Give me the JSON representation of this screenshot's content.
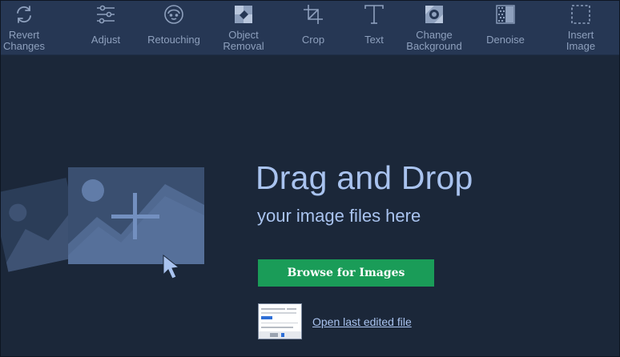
{
  "toolbar": {
    "items": [
      {
        "label": "Revert\nChanges",
        "icon": "revert-icon"
      },
      {
        "label": "Adjust",
        "icon": "sliders-icon"
      },
      {
        "label": "Retouching",
        "icon": "face-icon"
      },
      {
        "label": "Object\nRemoval",
        "icon": "eraser-icon"
      },
      {
        "label": "Crop",
        "icon": "crop-icon"
      },
      {
        "label": "Text",
        "icon": "text-icon"
      },
      {
        "label": "Change\nBackground",
        "icon": "background-icon"
      },
      {
        "label": "Denoise",
        "icon": "denoise-icon"
      },
      {
        "label": "Insert\nImage",
        "icon": "insert-image-icon"
      }
    ]
  },
  "main": {
    "headline": "Drag and Drop",
    "subline": "your image files here",
    "browse_label": "Browse for Images",
    "last_file_label": "Open last edited file"
  },
  "colors": {
    "background": "#1b2739",
    "toolbar": "#263754",
    "accent_text": "#a9c3ef",
    "browse_button": "#1a9c58"
  }
}
